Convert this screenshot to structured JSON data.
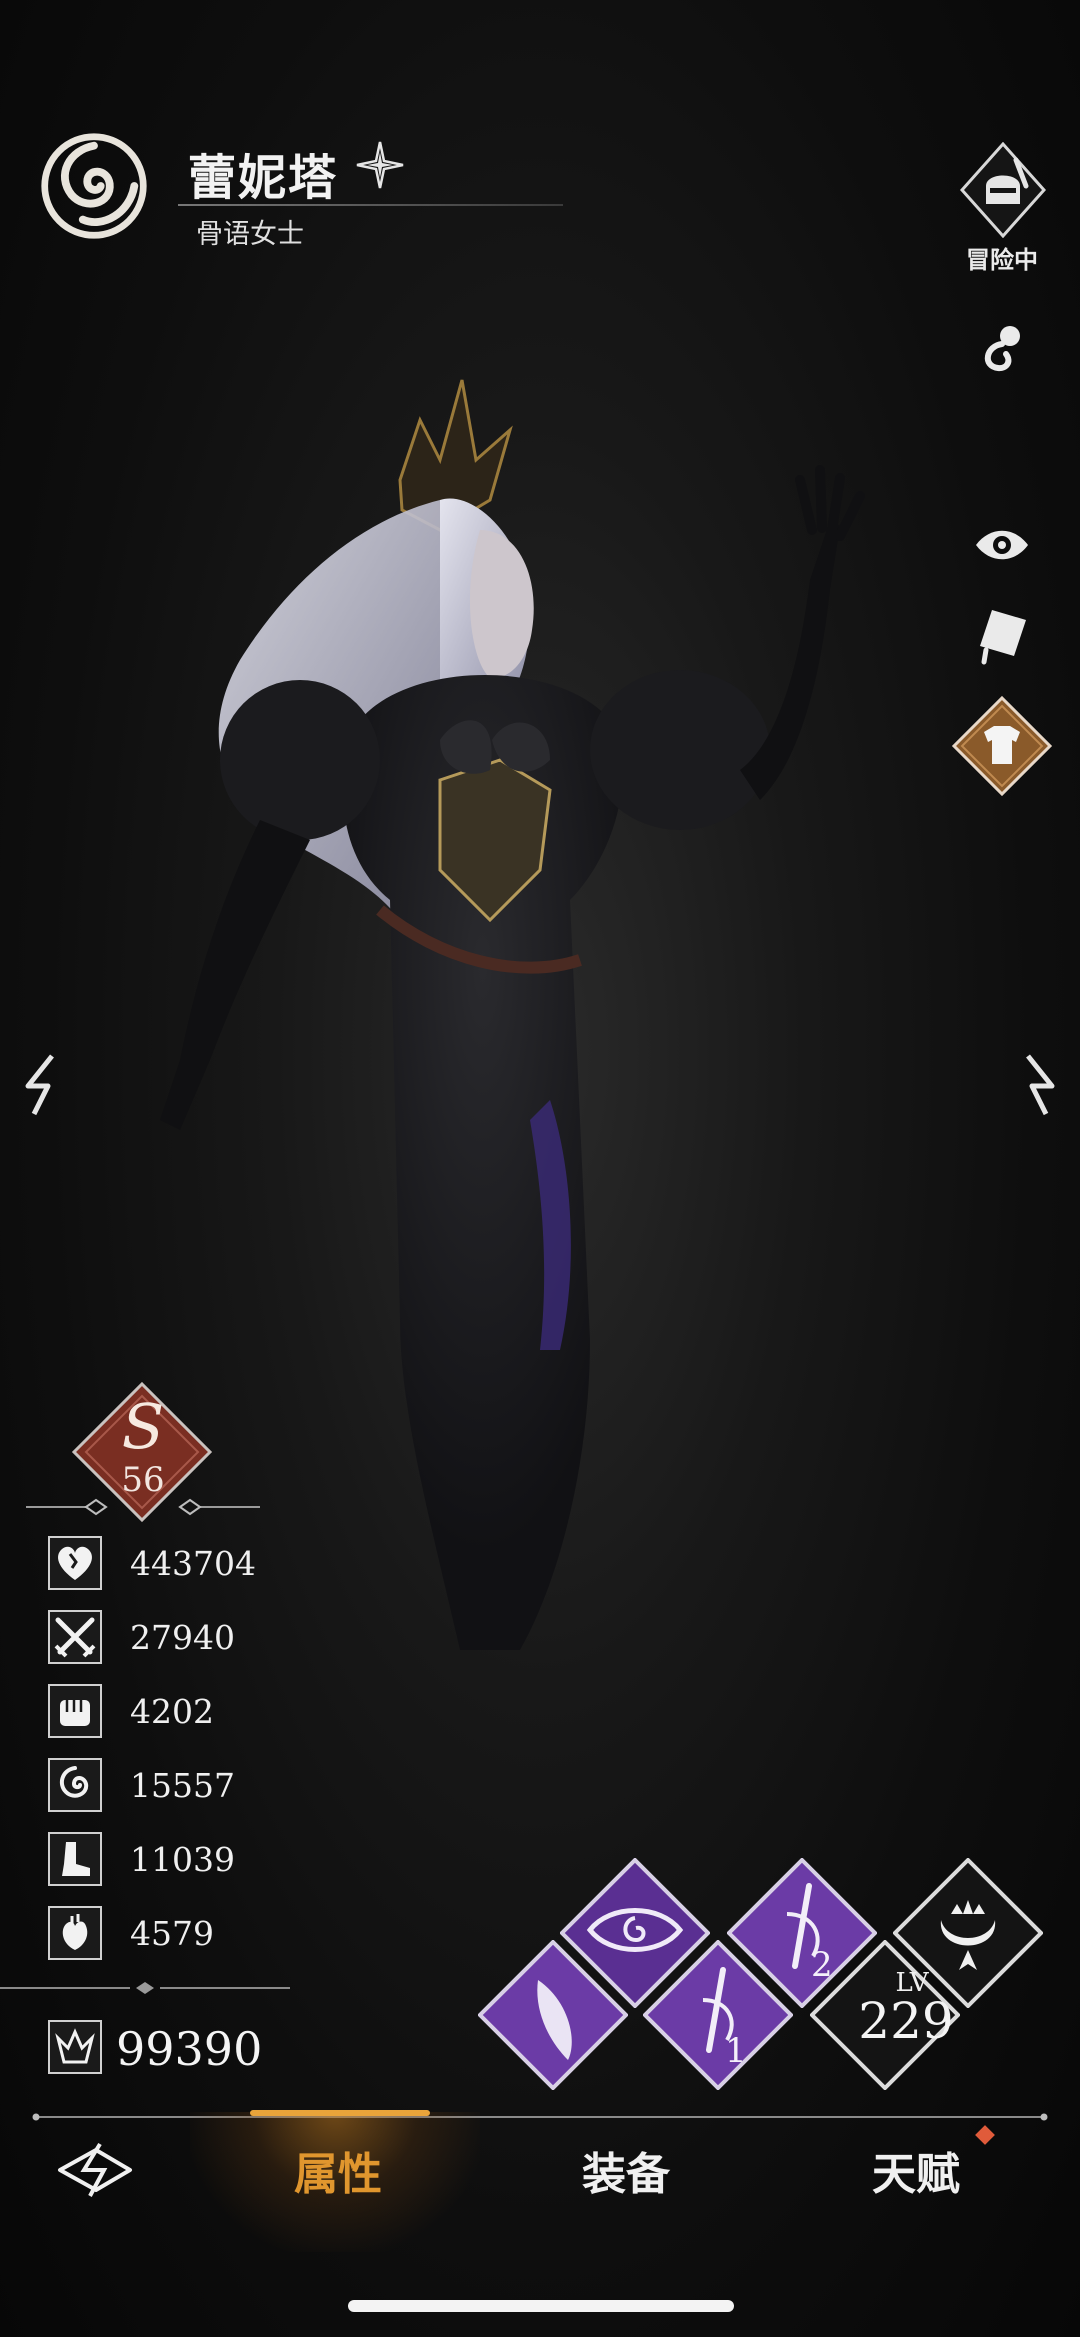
{
  "hero": {
    "name": "蕾妮塔",
    "title": "骨语女士"
  },
  "right_rail": {
    "adventure_label": "冒险中"
  },
  "rank": {
    "letter": "S",
    "number": "56"
  },
  "stats": [
    {
      "icon": "heart-health-icon",
      "value": "443704"
    },
    {
      "icon": "crossed-swords-icon",
      "value": "27940"
    },
    {
      "icon": "fist-icon",
      "value": "4202"
    },
    {
      "icon": "swirl-icon",
      "value": "15557"
    },
    {
      "icon": "boot-icon",
      "value": "11039"
    },
    {
      "icon": "anatomical-heart-icon",
      "value": "4579"
    }
  ],
  "power": {
    "icon": "crown-power-icon",
    "value": "99390"
  },
  "skills": {
    "level_label": "LV",
    "level_value": "229",
    "skill_1_badge": "1",
    "skill_2_badge": "2"
  },
  "nav": {
    "tabs": [
      "属性",
      "装备",
      "天赋"
    ],
    "active_tab": "属性",
    "accent_color": "#e0962e",
    "notification_color": "#e05b3a"
  }
}
